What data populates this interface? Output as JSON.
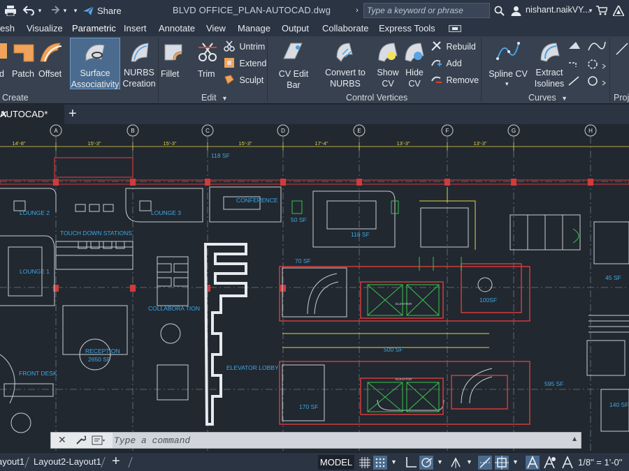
{
  "titlebar": {
    "share_label": "Share",
    "document_title": "BLVD OFFICE_PLAN-AUTOCAD.dwg",
    "search_placeholder": "Type a keyword or phrase",
    "user_name": "nishant.naikVY..."
  },
  "menubar": {
    "items": [
      "esh",
      "Visualize",
      "Parametric",
      "Insert",
      "Annotate",
      "View",
      "Manage",
      "Output",
      "Collaborate",
      "Express Tools"
    ]
  },
  "ribbon": {
    "create_panel": {
      "title": "Create",
      "buttons": [
        "nd",
        "Patch",
        "Offset"
      ],
      "surface_associativity": [
        "Surface",
        "Associativity"
      ],
      "nurbs_creation": [
        "NURBS",
        "Creation"
      ]
    },
    "edit_panel": {
      "title": "Edit",
      "fillet": "Fillet",
      "trim": "Trim",
      "untrim": "Untrim",
      "extend": "Extend",
      "sculpt": "Sculpt"
    },
    "control_vertices_panel": {
      "title": "Control Vertices",
      "cv_edit_bar": "CV Edit Bar",
      "convert_to_nurbs": [
        "Convert to",
        "NURBS"
      ],
      "show_cv": [
        "Show",
        "CV"
      ],
      "hide_cv": [
        "Hide",
        "CV"
      ],
      "rebuild": "Rebuild",
      "add": "Add",
      "remove": "Remove"
    },
    "curves_panel": {
      "title": "Curves",
      "spline_cv": "Spline CV",
      "extract_isolines": [
        "Extract",
        "Isolines"
      ]
    },
    "project_panel": {
      "title": "Proj"
    }
  },
  "tabs": {
    "active_file": "AUTOCAD*"
  },
  "drawing": {
    "grid_letters": [
      "A",
      "B",
      "C",
      "D",
      "E",
      "F",
      "G",
      "H"
    ],
    "dimensions": [
      "14'-8\"",
      "15'-3\"",
      "15'-3\"",
      "15'-3\"",
      "17'-4\"",
      "13'-3\""
    ],
    "rooms": {
      "area_118": "118 SF",
      "lounge_2": "LOUNGE 2",
      "lounge_3": "LOUNGE 3",
      "conference": "CONFERENCE",
      "area_50": "50 SF",
      "area_118b": "118 SF",
      "touch_down": "TOUCH DOWN STATIONS",
      "lounge_1": "LOUNGE 1",
      "area_70": "70 SF",
      "area_100": "100SF",
      "area_45": "45 SF",
      "collaboration": "COLLABORA TION",
      "reception": "RECEPTION",
      "reception_area": "2650 SF",
      "elevator_lobby": "ELEVATOR LOBBY",
      "area_500": "500 SF",
      "front_desk": "FRONT DESK",
      "area_595": "595 SF",
      "area_170": "170 SF",
      "area_140": "140 SF",
      "elevator_1": "ELEVATOR",
      "elevator_2": "ELEVATOR"
    }
  },
  "command_line": {
    "placeholder": "Type a command"
  },
  "statusbar": {
    "layouts": [
      "ayout1",
      "Layout2-Layout1"
    ],
    "model_label": "MODEL",
    "scale": "1/8\" = 1'-0\""
  }
}
